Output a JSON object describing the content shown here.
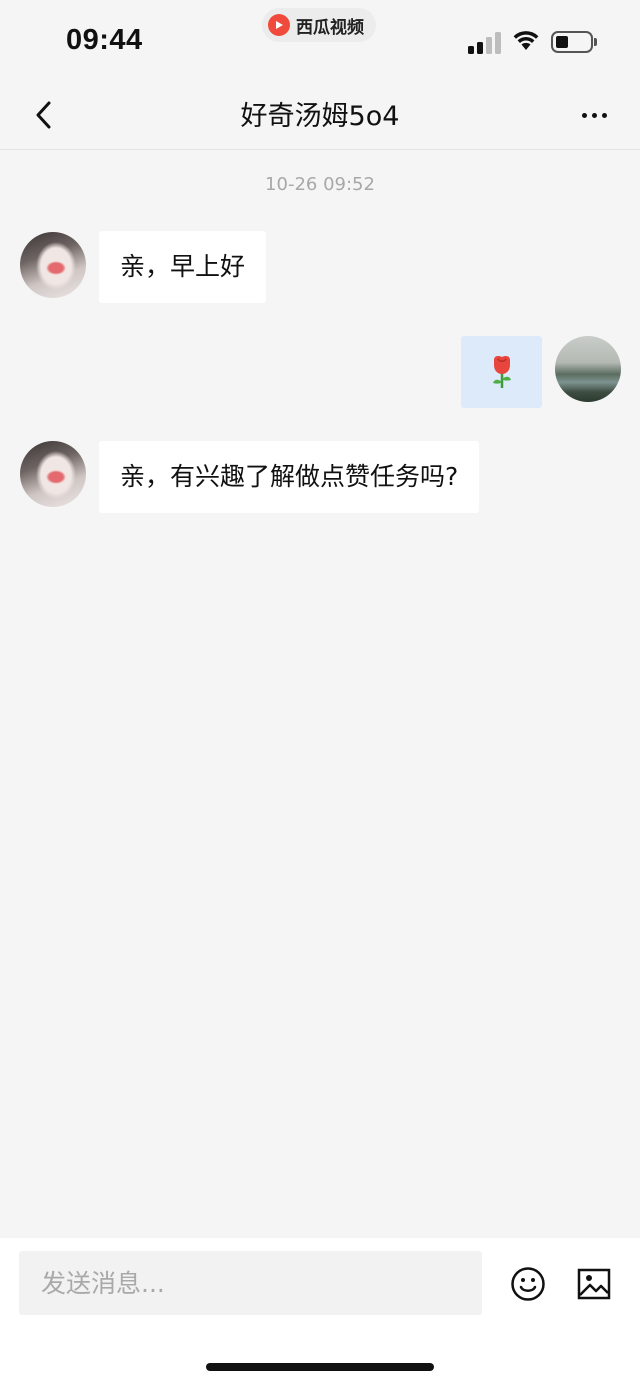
{
  "status_bar": {
    "time": "09:44",
    "app_badge_label": "西瓜视频",
    "icons": [
      "signal-icon",
      "wifi-icon",
      "battery-icon"
    ]
  },
  "nav": {
    "title": "好奇汤姆5o4",
    "back_icon": "chevron-left-icon",
    "more_icon": "more-dots-icon"
  },
  "chat": {
    "timestamp": "10-26 09:52",
    "messages": [
      {
        "sender": "other",
        "type": "text",
        "text": "亲，早上好"
      },
      {
        "sender": "self",
        "type": "emoji",
        "emoji": "rose"
      },
      {
        "sender": "other",
        "type": "text",
        "text": "亲，有兴趣了解做点赞任务吗?"
      }
    ]
  },
  "input": {
    "placeholder": "发送消息...",
    "emoji_icon": "smiley-icon",
    "image_icon": "image-icon"
  },
  "colors": {
    "background": "#f5f5f5",
    "self_bubble": "#dceafa",
    "other_bubble": "#ffffff",
    "app_badge": "#f04a3c"
  }
}
